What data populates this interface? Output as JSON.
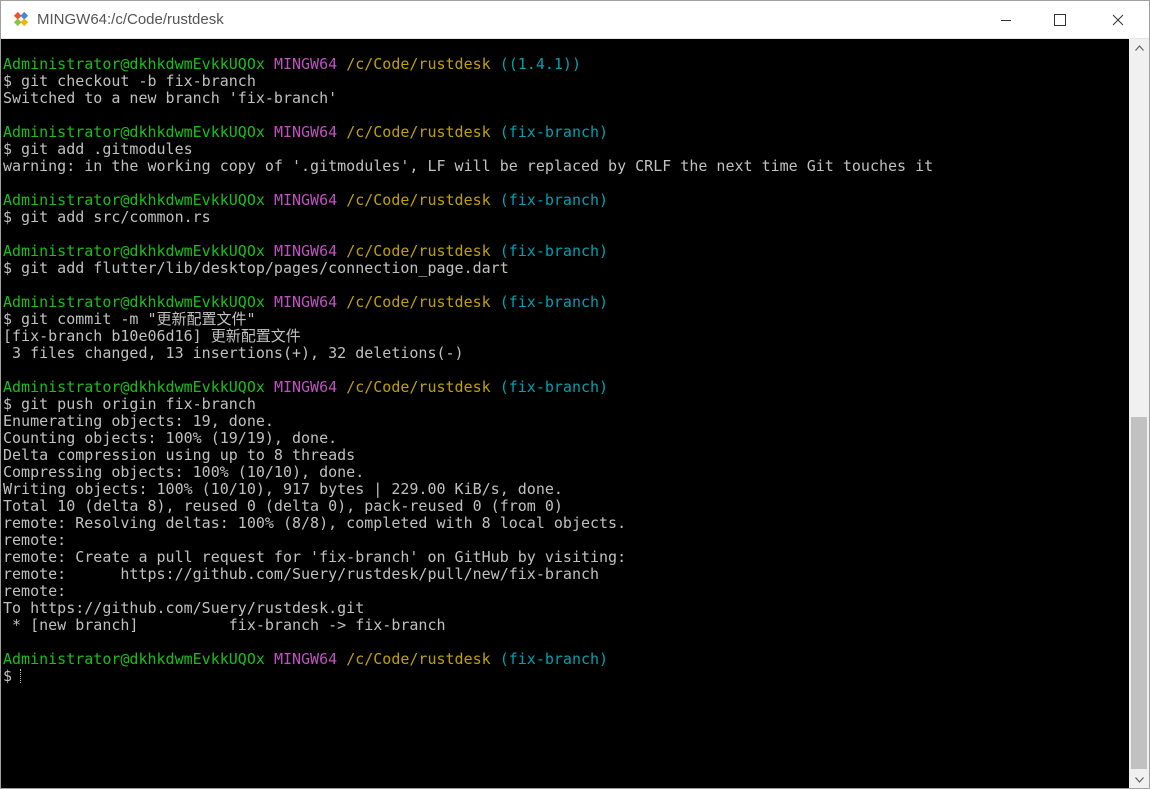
{
  "window": {
    "title": "MINGW64:/c/Code/rustdesk",
    "controls": {
      "minimize": "minimize-icon",
      "maximize": "maximize-icon",
      "close": "close-icon"
    },
    "icon": "git-icon"
  },
  "colors": {
    "user": "#17bf17",
    "system": "#c050c0",
    "path": "#c0a000",
    "branch": "#00a0b0",
    "text": "#c0c0c0",
    "background": "#000000"
  },
  "terminal": {
    "lines": [
      {
        "type": "prompt",
        "user": "Administrator@dkhkdwmEvkkUQOx",
        "system": "MINGW64",
        "path": "/c/Code/rustdesk",
        "branch": "((1.4.1))"
      },
      {
        "type": "text",
        "text": "$ git checkout -b fix-branch"
      },
      {
        "type": "text",
        "text": "Switched to a new branch 'fix-branch'"
      },
      {
        "type": "blank",
        "text": ""
      },
      {
        "type": "prompt",
        "user": "Administrator@dkhkdwmEvkkUQOx",
        "system": "MINGW64",
        "path": "/c/Code/rustdesk",
        "branch": "(fix-branch)"
      },
      {
        "type": "text",
        "text": "$ git add .gitmodules"
      },
      {
        "type": "text",
        "text": "warning: in the working copy of '.gitmodules', LF will be replaced by CRLF the next time Git touches it"
      },
      {
        "type": "blank",
        "text": ""
      },
      {
        "type": "prompt",
        "user": "Administrator@dkhkdwmEvkkUQOx",
        "system": "MINGW64",
        "path": "/c/Code/rustdesk",
        "branch": "(fix-branch)"
      },
      {
        "type": "text",
        "text": "$ git add src/common.rs"
      },
      {
        "type": "blank",
        "text": ""
      },
      {
        "type": "prompt",
        "user": "Administrator@dkhkdwmEvkkUQOx",
        "system": "MINGW64",
        "path": "/c/Code/rustdesk",
        "branch": "(fix-branch)"
      },
      {
        "type": "text",
        "text": "$ git add flutter/lib/desktop/pages/connection_page.dart"
      },
      {
        "type": "blank",
        "text": ""
      },
      {
        "type": "prompt",
        "user": "Administrator@dkhkdwmEvkkUQOx",
        "system": "MINGW64",
        "path": "/c/Code/rustdesk",
        "branch": "(fix-branch)"
      },
      {
        "type": "text",
        "text": "$ git commit -m \"更新配置文件\""
      },
      {
        "type": "text",
        "text": "[fix-branch b10e06d16] 更新配置文件"
      },
      {
        "type": "text",
        "text": " 3 files changed, 13 insertions(+), 32 deletions(-)"
      },
      {
        "type": "blank",
        "text": ""
      },
      {
        "type": "prompt",
        "user": "Administrator@dkhkdwmEvkkUQOx",
        "system": "MINGW64",
        "path": "/c/Code/rustdesk",
        "branch": "(fix-branch)"
      },
      {
        "type": "text",
        "text": "$ git push origin fix-branch"
      },
      {
        "type": "text",
        "text": "Enumerating objects: 19, done."
      },
      {
        "type": "text",
        "text": "Counting objects: 100% (19/19), done."
      },
      {
        "type": "text",
        "text": "Delta compression using up to 8 threads"
      },
      {
        "type": "text",
        "text": "Compressing objects: 100% (10/10), done."
      },
      {
        "type": "text",
        "text": "Writing objects: 100% (10/10), 917 bytes | 229.00 KiB/s, done."
      },
      {
        "type": "text",
        "text": "Total 10 (delta 8), reused 0 (delta 0), pack-reused 0 (from 0)"
      },
      {
        "type": "text",
        "text": "remote: Resolving deltas: 100% (8/8), completed with 8 local objects."
      },
      {
        "type": "text",
        "text": "remote:"
      },
      {
        "type": "text",
        "text": "remote: Create a pull request for 'fix-branch' on GitHub by visiting:"
      },
      {
        "type": "text",
        "text": "remote:      https://github.com/Suery/rustdesk/pull/new/fix-branch"
      },
      {
        "type": "text",
        "text": "remote:"
      },
      {
        "type": "text",
        "text": "To https://github.com/Suery/rustdesk.git"
      },
      {
        "type": "text",
        "text": " * [new branch]          fix-branch -> fix-branch"
      },
      {
        "type": "blank",
        "text": ""
      },
      {
        "type": "prompt",
        "user": "Administrator@dkhkdwmEvkkUQOx",
        "system": "MINGW64",
        "path": "/c/Code/rustdesk",
        "branch": "(fix-branch)"
      },
      {
        "type": "input",
        "text": "$"
      }
    ]
  },
  "scrollbar": {
    "up": "scroll-up-arrow-icon",
    "down": "scroll-down-arrow-icon",
    "position": 0.52
  }
}
